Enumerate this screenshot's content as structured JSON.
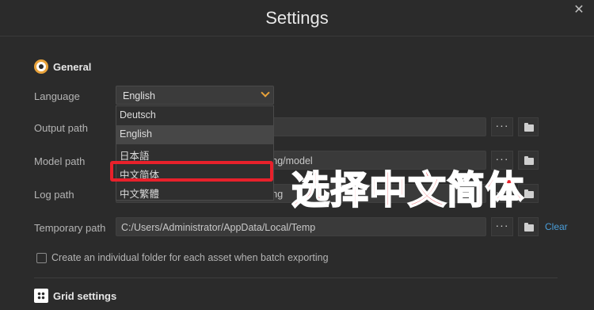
{
  "window": {
    "title": "Settings"
  },
  "general": {
    "heading": "General",
    "language": {
      "label": "Language",
      "value": "English",
      "options": [
        "Deutsch",
        "English",
        "日本語",
        "中文简体",
        "中文繁體"
      ]
    },
    "output_path": {
      "label": "Output path",
      "value": ""
    },
    "model_path": {
      "label": "Model path",
      "value": "ting/model"
    },
    "log_path": {
      "label": "Log path",
      "value": "ting"
    },
    "temp_path": {
      "label": "Temporary path",
      "value": "C:/Users/Administrator/AppData/Local/Temp"
    },
    "browse_label": "···",
    "clear_label": "Clear",
    "batch_folder_label": "Create an individual folder for each asset when batch exporting"
  },
  "grid": {
    "heading": "Grid settings"
  },
  "annotation": {
    "text": "选择中文简体",
    "color": "#e8212b"
  }
}
